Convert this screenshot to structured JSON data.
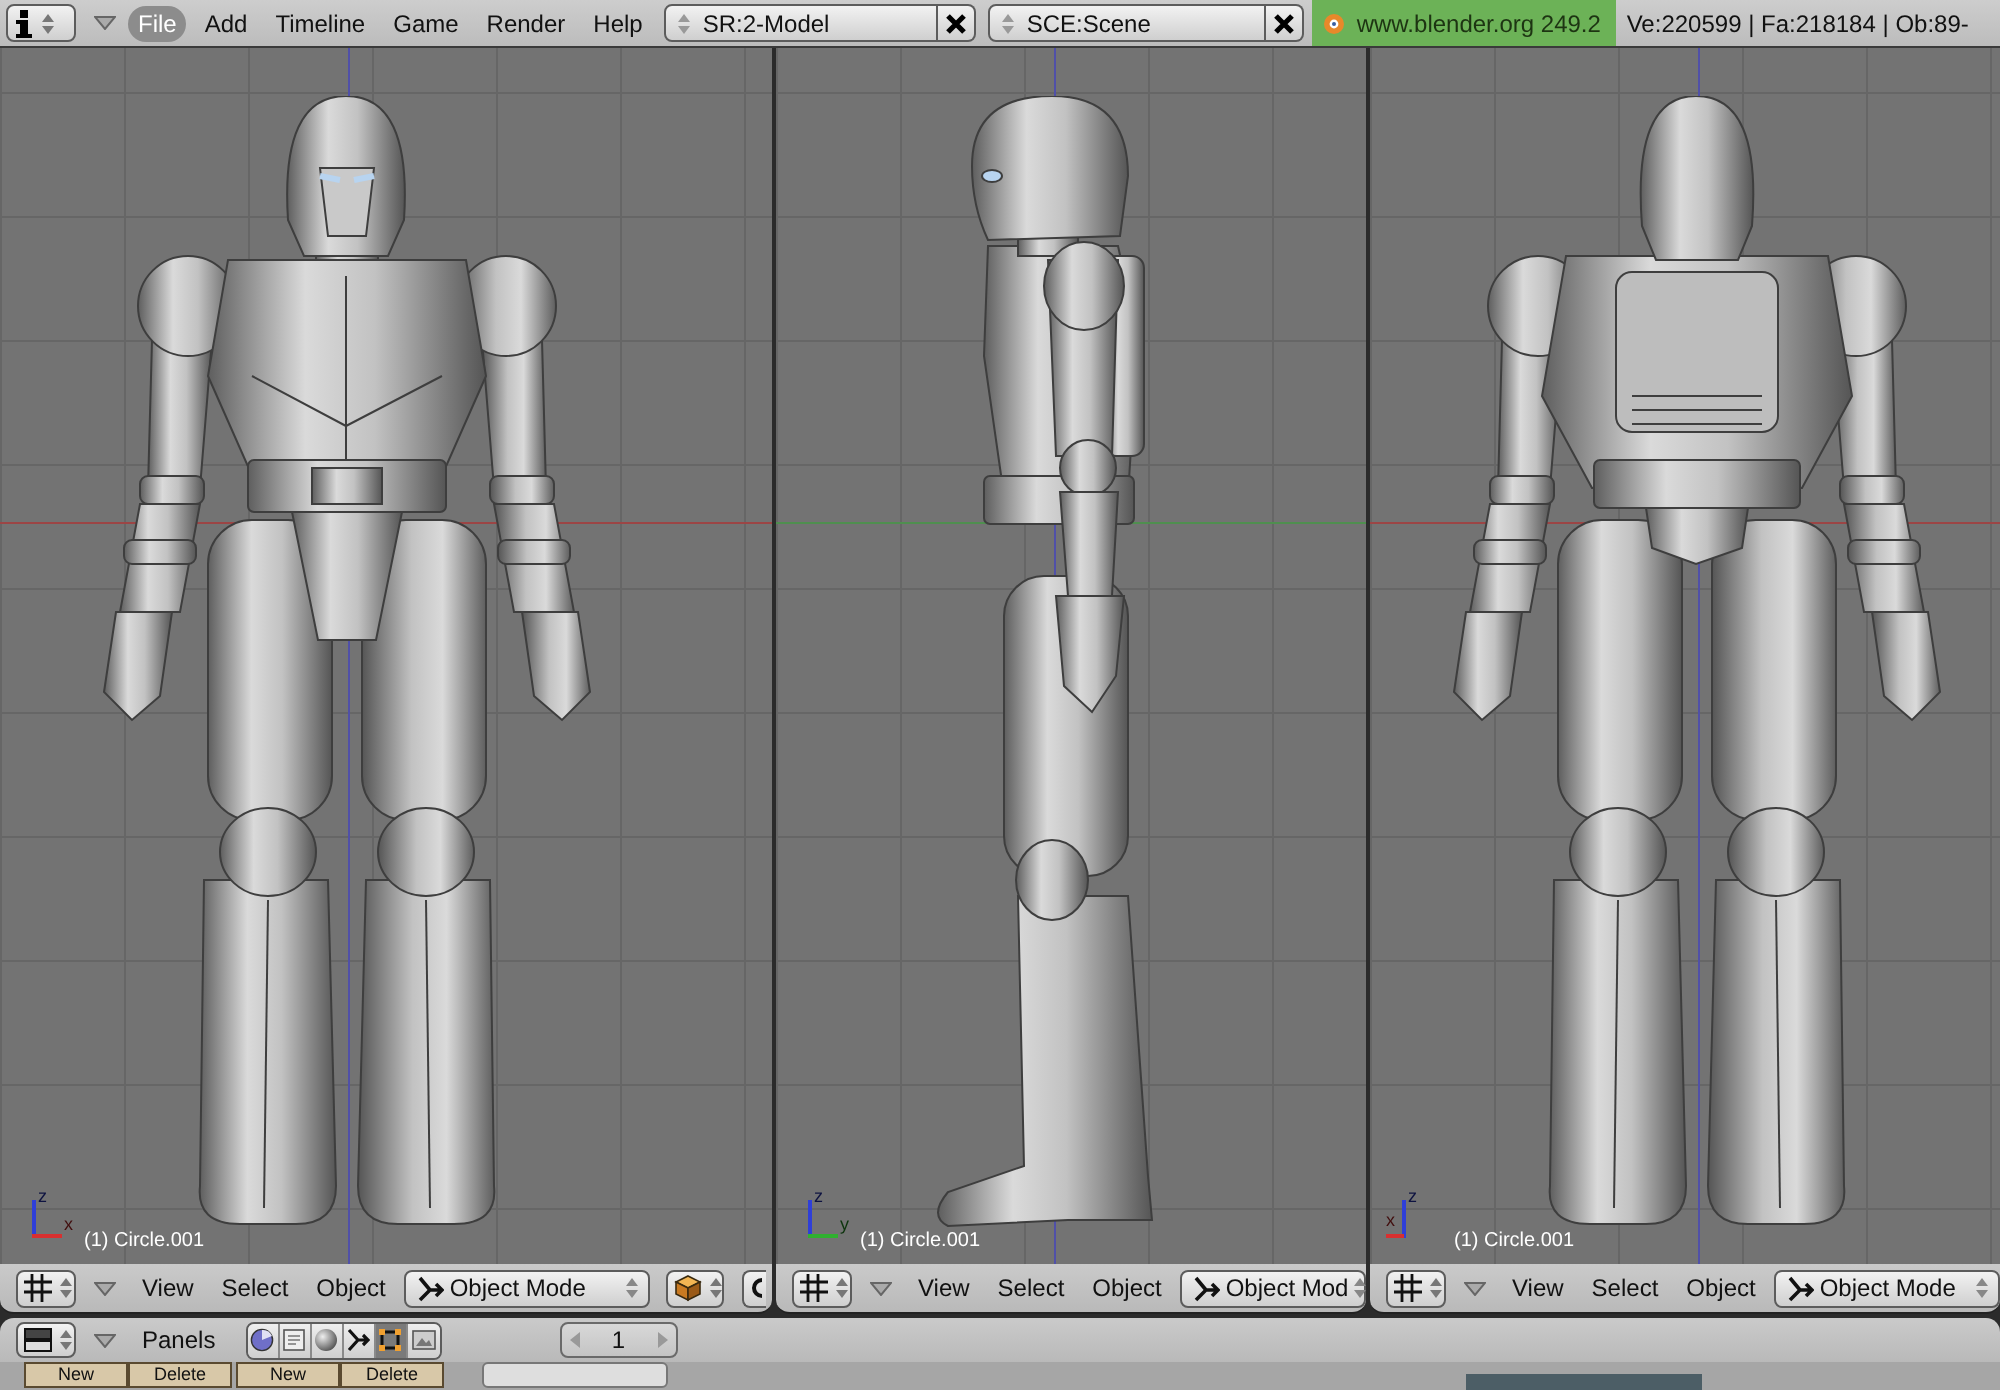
{
  "top_bar": {
    "menus": [
      {
        "label": "File",
        "selected": true
      },
      {
        "label": "Add",
        "selected": false
      },
      {
        "label": "Timeline",
        "selected": false
      },
      {
        "label": "Game",
        "selected": false
      },
      {
        "label": "Render",
        "selected": false
      },
      {
        "label": "Help",
        "selected": false
      }
    ],
    "screen_selector": {
      "value": "SR:2-Model"
    },
    "scene_selector": {
      "value": "SCE:Scene"
    },
    "version": "www.blender.org 249.2",
    "stats": "Ve:220599 | Fa:218184 | Ob:89-"
  },
  "viewports": [
    {
      "model": {
        "kind": "front"
      },
      "world_axes": [
        {
          "kind": "horizontal",
          "color": "#9c4545"
        },
        {
          "kind": "vertical",
          "color": "#5050a8"
        }
      ],
      "gizmo": [
        {
          "kind": "up",
          "label": "z",
          "color": "#2f3fd8"
        },
        {
          "kind": "right",
          "label": "x",
          "color": "#d83030"
        }
      ],
      "object_label": "(1) Circle.001",
      "header": {
        "menus": [
          "View",
          "Select",
          "Object"
        ],
        "mode": "Object Mode",
        "tools": [
          {
            "kind": "draw-type"
          },
          {
            "kind": "pivot"
          }
        ]
      }
    },
    {
      "model": {
        "kind": "side"
      },
      "world_axes": [
        {
          "kind": "horizontal",
          "color": "#4f8f4f"
        },
        {
          "kind": "vertical",
          "color": "#5050a8"
        }
      ],
      "gizmo": [
        {
          "kind": "up",
          "label": "z",
          "color": "#2f3fd8"
        },
        {
          "kind": "right",
          "label": "y",
          "color": "#30b030"
        }
      ],
      "object_label": "(1) Circle.001",
      "header": {
        "menus": [
          "View",
          "Select",
          "Object"
        ],
        "mode": "Object Mod"
      }
    },
    {
      "model": {
        "kind": "back"
      },
      "world_axes": [
        {
          "kind": "horizontal",
          "color": "#9c4545"
        },
        {
          "kind": "vertical",
          "color": "#5050a8"
        }
      ],
      "gizmo": [
        {
          "kind": "up",
          "label": "z",
          "color": "#2f3fd8"
        },
        {
          "kind": "left",
          "label": "x",
          "color": "#d83030"
        }
      ],
      "object_label": "(1) Circle.001",
      "header": {
        "menus": [
          "View",
          "Select",
          "Object"
        ],
        "mode": "Object Mode"
      }
    }
  ],
  "buttons_window": {
    "header": {
      "label": "Panels",
      "contexts": [
        {
          "kind": "logic",
          "selected": false
        },
        {
          "kind": "script",
          "selected": false
        },
        {
          "kind": "shading",
          "selected": false
        },
        {
          "kind": "object",
          "selected": false
        },
        {
          "kind": "editing",
          "selected": true
        },
        {
          "kind": "scene",
          "selected": false
        }
      ],
      "frame": "1"
    },
    "panel_buttons": [
      "New",
      "Delete",
      "New",
      "Delete"
    ]
  }
}
